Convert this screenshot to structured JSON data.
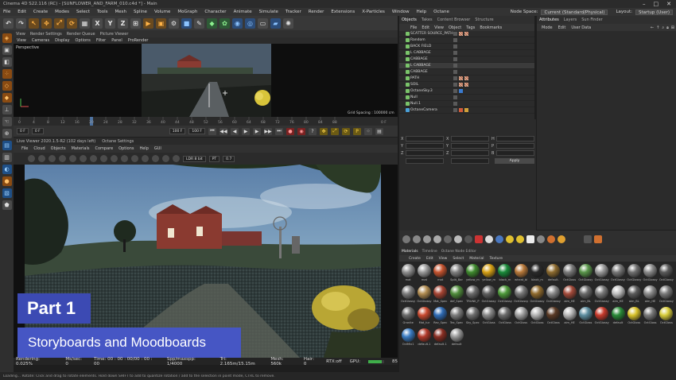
{
  "window": {
    "title": "Cinema 4D S22.116 (RC) - [SUNFLOWER_AND_FARM_010.c4d *] - Main",
    "minimize": "–",
    "maximize": "□",
    "close": "✕"
  },
  "menubar": {
    "items": [
      "File",
      "Edit",
      "Create",
      "Modes",
      "Select",
      "Tools",
      "Mesh",
      "Spline",
      "Volume",
      "MoGraph",
      "Character",
      "Animate",
      "Simulate",
      "Tracker",
      "Render",
      "Extensions",
      "X-Particles",
      "Window",
      "Help",
      "Octane"
    ],
    "node_space_label": "Node Space:",
    "node_space_value": "Current (Standard/Physical)",
    "layout_label": "Layout:",
    "layout_value": "Startup (User)"
  },
  "viewport": {
    "menu_tabs": [
      "View",
      "Render Settings",
      "Render Queue",
      "Picture Viewer"
    ],
    "menu": [
      "View",
      "Cameras",
      "Display",
      "Options",
      "Filter",
      "Panel",
      "ProRender"
    ],
    "label": "Perspective",
    "grid_spacing": "Grid Spacing : 100000 cm"
  },
  "timeline": {
    "ticks": [
      "0",
      "4",
      "8",
      "12",
      "16",
      "20",
      "24",
      "28",
      "32",
      "36",
      "40",
      "44",
      "48",
      "52",
      "56",
      "60",
      "64",
      "68",
      "72",
      "76",
      "80",
      "84",
      "88"
    ],
    "end_label": "0 F",
    "start_field": "0 F",
    "current_field": "0 F",
    "end_field": "100 F",
    "end_field2": "100 F"
  },
  "live_viewer": {
    "title": "Live Viewer 2020.1.5-R2 (102 days left)",
    "title_right": "Octane Settings",
    "menu": [
      "File",
      "Cloud",
      "Objects",
      "Materials",
      "Compare",
      "Options",
      "Help",
      "GUI"
    ],
    "mode_value": "LDR 8 bit",
    "tone_value": "PT",
    "value_field": "0.7"
  },
  "render_status": {
    "rendering": "Rendering: 0.025%",
    "ms_sec": "Ms/sec: 0",
    "time": "Time: 00 : 00 : 00/00 : 00 : 00",
    "spp": "Spp/maxspp: 1/4000",
    "tri": "Tri: 2.165m/15.15m",
    "mesh": "Mesh: 560k",
    "hair": "Hair: 0",
    "rtx": "RTX:off",
    "gpu_label": "GPU:",
    "gpu_value": "85",
    "gpu_percent": 85
  },
  "overlay": {
    "part": "Part 1",
    "subtitle": "Storyboards and Moodboards"
  },
  "objects_panel": {
    "tabs": [
      "Objects",
      "Takes",
      "Content Browser",
      "Structure"
    ],
    "menu": [
      "File",
      "Edit",
      "View",
      "Object",
      "Tags",
      "Bookmarks"
    ],
    "rows": [
      {
        "name": "SCATTER SOURCE_PATH"
      },
      {
        "name": "Random"
      },
      {
        "name": "BACK FIELD"
      },
      {
        "name": "L CABBAGE"
      },
      {
        "name": "CABBAGE"
      },
      {
        "name": "L CABBAGE"
      },
      {
        "name": "CABBAGE"
      },
      {
        "name": "PATH"
      },
      {
        "name": "SOIL"
      },
      {
        "name": "OctaneSky.3"
      },
      {
        "name": "Null"
      },
      {
        "name": "Null.1"
      },
      {
        "name": "OctaneCamera"
      }
    ]
  },
  "attributes_panel": {
    "tabs": [
      "Attributes",
      "Layers",
      "Sun Finder"
    ],
    "menu": [
      "Mode",
      "Edit",
      "User Data"
    ]
  },
  "coordinates": {
    "labels": [
      "X",
      "Y",
      "Z"
    ],
    "size_labels": [
      "H",
      "P",
      "B"
    ],
    "apply": "Apply"
  },
  "materials_panel": {
    "tabs": [
      "Materials",
      "Timeline",
      "Octane Node Editor"
    ],
    "menu": [
      "Create",
      "Edit",
      "View",
      "Select",
      "Material",
      "Texture"
    ],
    "items": [
      {
        "label": "mat",
        "color": "#8f8f8f"
      },
      {
        "label": "mat",
        "color": "#9a9a9a"
      },
      {
        "label": "mat",
        "color": "#c5532f"
      },
      {
        "label": "Split_Bar",
        "color": "#808080"
      },
      {
        "label": "yellow_m",
        "color": "#3f8a2e"
      },
      {
        "label": "yellow_m",
        "color": "#d6a015"
      },
      {
        "label": "black_m",
        "color": "#1a8a3a"
      },
      {
        "label": "wheat_bl",
        "color": "#b8793a"
      },
      {
        "label": "black_m",
        "color": "#2a2a2a"
      },
      {
        "label": "default.",
        "color": "#8d6b2f"
      },
      {
        "label": "OctGloss",
        "color": "#7a7a7a"
      },
      {
        "label": "OctGlossy",
        "color": "#59954a"
      },
      {
        "label": "OctGlossy",
        "color": "#9a9a9a"
      },
      {
        "label": "OctGlossy",
        "color": "#777"
      },
      {
        "label": "OctGlossy",
        "color": "#6f6f6f"
      },
      {
        "label": "OctGlossy",
        "color": "#8a8a8a"
      },
      {
        "label": "OctGlossy",
        "color": "#5a5a5a"
      },
      {
        "label": "OctGlossy",
        "color": "#7d7d7d"
      },
      {
        "label": "OctGlossy",
        "color": "#b28d52"
      },
      {
        "label": "Mat_Spec",
        "color": "#a64433"
      },
      {
        "label": "def_Spec",
        "color": "#4f8c3b"
      },
      {
        "label": "TRUNK_P",
        "color": "#6b6b6b"
      },
      {
        "label": "OctGlossy",
        "color": "#5f5f5f"
      },
      {
        "label": "OctGlossy",
        "color": "#4e9a3a"
      },
      {
        "label": "OctGlossy",
        "color": "#777"
      },
      {
        "label": "OctGlossy",
        "color": "#8f6a2d"
      },
      {
        "label": "OctGlossy",
        "color": "#8a8a8a"
      },
      {
        "label": "aim_HE",
        "color": "#a34a3a"
      },
      {
        "label": "aim_BL",
        "color": "#6a6a6a"
      },
      {
        "label": "OctGlossy",
        "color": "#7a7a7a"
      },
      {
        "label": "aim_HE",
        "color": "#c0c0c0"
      },
      {
        "label": "aim_BL",
        "color": "#5c5c5c"
      },
      {
        "label": "aim_HE",
        "color": "#8b8b8b"
      },
      {
        "label": "OctGlossy",
        "color": "#7a7a7a"
      },
      {
        "label": "Granite",
        "color": "#6b6b6b"
      },
      {
        "label": "Mat_tur",
        "color": "#c94a30"
      },
      {
        "label": "Rev_Spec",
        "color": "#2f6bb5"
      },
      {
        "label": "Tex_Spec",
        "color": "#7d7d7d"
      },
      {
        "label": "Sky_Spec",
        "color": "#6f6f6f"
      },
      {
        "label": "OctGloss",
        "color": "#888"
      },
      {
        "label": "OctGloss",
        "color": "#6c6c6c"
      },
      {
        "label": "OctGloss",
        "color": "#a0a0a0"
      },
      {
        "label": "OctGloss",
        "color": "#b5b5b5"
      },
      {
        "label": "OctGloss",
        "color": "#5b3a25"
      },
      {
        "label": "aim_HE",
        "color": "#b8b8b8"
      },
      {
        "label": "OctGlass",
        "color": "#5d8ea0"
      },
      {
        "label": "OctGlossy",
        "color": "#c73a2c"
      },
      {
        "label": "default",
        "color": "#2a8a38"
      },
      {
        "label": "OctGloss",
        "color": "#d8c22a"
      },
      {
        "label": "OctGloss",
        "color": "#7a7a7a"
      },
      {
        "label": "OctGloss",
        "color": "#d7cc3a"
      },
      {
        "label": "OctMix1",
        "color": "#3a7bc2"
      },
      {
        "label": "default.1",
        "color": "#b23a2a"
      },
      {
        "label": "default.1",
        "color": "#8a2e22"
      },
      {
        "label": "default",
        "color": "#999"
      }
    ]
  },
  "statusbar": {
    "text": "Loading... Rotate: Click and drag to rotate elements. Hold down SHIFT to add to quantize rotation / add to the selection in point mode, CTRL to remove."
  }
}
